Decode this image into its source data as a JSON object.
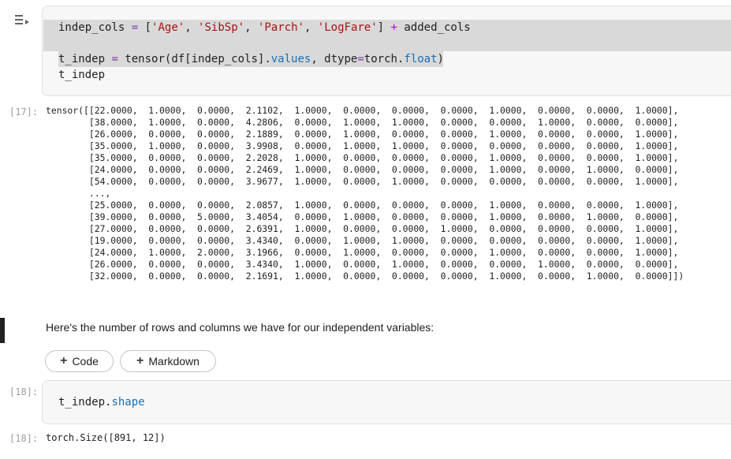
{
  "cell1": {
    "line1": {
      "var": "indep_cols",
      "eq": " = ",
      "open": "[",
      "s1": "'Age'",
      "sep1": ", ",
      "s2": "'SibSp'",
      "sep2": ", ",
      "s3": "'Parch'",
      "sep3": ", ",
      "s4": "'LogFare'",
      "close": "] ",
      "plus": "+",
      "rest": " added_cols"
    },
    "line2": {
      "var": "t_indep",
      "eq": " = ",
      "call": "tensor(df[indep_cols].",
      "values": "values",
      "mid": ", dtype",
      "eq2": "=",
      "torch": "torch.",
      "float": "float",
      "end": ")"
    },
    "line3": "t_indep"
  },
  "output1": {
    "exec_label": "[17]:",
    "text": "tensor([[22.0000,  1.0000,  0.0000,  2.1102,  1.0000,  0.0000,  0.0000,  0.0000,  1.0000,  0.0000,  0.0000,  1.0000],\n        [38.0000,  1.0000,  0.0000,  4.2806,  0.0000,  1.0000,  1.0000,  0.0000,  0.0000,  1.0000,  0.0000,  0.0000],\n        [26.0000,  0.0000,  0.0000,  2.1889,  0.0000,  1.0000,  0.0000,  0.0000,  1.0000,  0.0000,  0.0000,  1.0000],\n        [35.0000,  1.0000,  0.0000,  3.9908,  0.0000,  1.0000,  1.0000,  0.0000,  0.0000,  0.0000,  0.0000,  1.0000],\n        [35.0000,  0.0000,  0.0000,  2.2028,  1.0000,  0.0000,  0.0000,  0.0000,  1.0000,  0.0000,  0.0000,  1.0000],\n        [24.0000,  0.0000,  0.0000,  2.2469,  1.0000,  0.0000,  0.0000,  0.0000,  1.0000,  0.0000,  1.0000,  0.0000],\n        [54.0000,  0.0000,  0.0000,  3.9677,  1.0000,  0.0000,  1.0000,  0.0000,  0.0000,  0.0000,  0.0000,  1.0000],\n        ...,\n        [25.0000,  0.0000,  0.0000,  2.0857,  1.0000,  0.0000,  0.0000,  0.0000,  1.0000,  0.0000,  0.0000,  1.0000],\n        [39.0000,  0.0000,  5.0000,  3.4054,  0.0000,  1.0000,  0.0000,  0.0000,  1.0000,  0.0000,  1.0000,  0.0000],\n        [27.0000,  0.0000,  0.0000,  2.6391,  1.0000,  0.0000,  0.0000,  1.0000,  0.0000,  0.0000,  0.0000,  1.0000],\n        [19.0000,  0.0000,  0.0000,  3.4340,  0.0000,  1.0000,  1.0000,  0.0000,  0.0000,  0.0000,  0.0000,  1.0000],\n        [24.0000,  1.0000,  2.0000,  3.1966,  0.0000,  1.0000,  0.0000,  0.0000,  1.0000,  0.0000,  0.0000,  1.0000],\n        [26.0000,  0.0000,  0.0000,  3.4340,  1.0000,  0.0000,  1.0000,  0.0000,  0.0000,  1.0000,  0.0000,  0.0000],\n        [32.0000,  0.0000,  0.0000,  2.1691,  1.0000,  0.0000,  0.0000,  0.0000,  1.0000,  0.0000,  1.0000,  0.0000]])"
  },
  "markdown": {
    "text": "Here's the number of rows and columns we have for our independent variables:"
  },
  "buttons": {
    "code_label": "Code",
    "markdown_label": "Markdown",
    "plus_glyph": "+"
  },
  "cell2": {
    "exec_label": "[18]:",
    "var": "t_indep.",
    "attr": "shape"
  },
  "output2": {
    "exec_label": "[18]:",
    "text": "torch.Size([891, 12])"
  },
  "colors": {
    "string": "#a31515",
    "operator": "#7a3e9d",
    "attribute": "#1a6fb5",
    "highlight": "#d9d9d9"
  }
}
